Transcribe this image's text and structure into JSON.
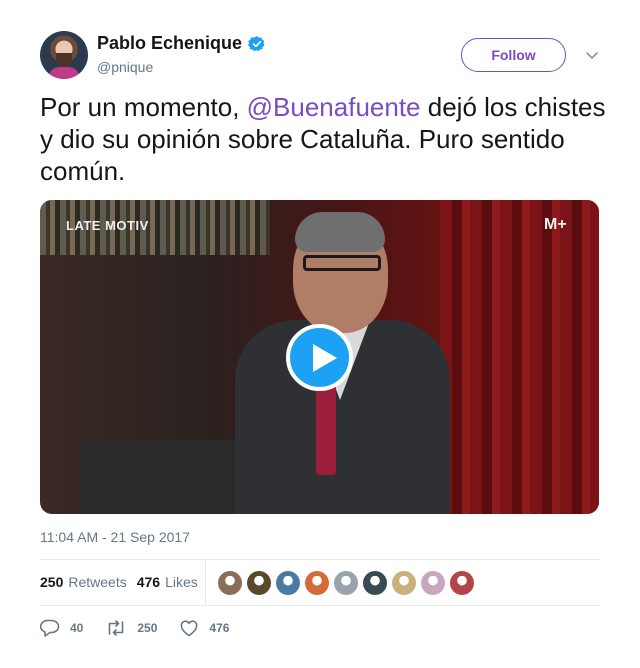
{
  "author": {
    "name": "Pablo Echenique",
    "handle": "@pnique",
    "verified": true
  },
  "follow_button": {
    "label": "Follow"
  },
  "tweet": {
    "text_before": "Por un momento, ",
    "mention": "@Buenafuente",
    "text_after": " dejó los chistes y dio su opinión sobre Cataluña. Puro sentido común."
  },
  "media": {
    "type": "video",
    "overlay_left": "LATE MOTIV",
    "overlay_right": "M+"
  },
  "timestamp": "11:04 AM - 21 Sep 2017",
  "stats": {
    "retweets_count": "250",
    "retweets_label": "Retweets",
    "likes_count": "476",
    "likes_label": "Likes"
  },
  "liker_avatar_colors": [
    "#8a6e5a",
    "#5b4a2a",
    "#4a7aa0",
    "#d66a3a",
    "#9aa3ad",
    "#3a4a52",
    "#c9b07a",
    "#c9a6c0",
    "#b5444a"
  ],
  "actions": {
    "reply_count": "40",
    "retweet_count": "250",
    "like_count": "476"
  },
  "colors": {
    "accent": "#794bc4",
    "verified_badge": "#1da1f2",
    "secondary_text": "#657786"
  }
}
